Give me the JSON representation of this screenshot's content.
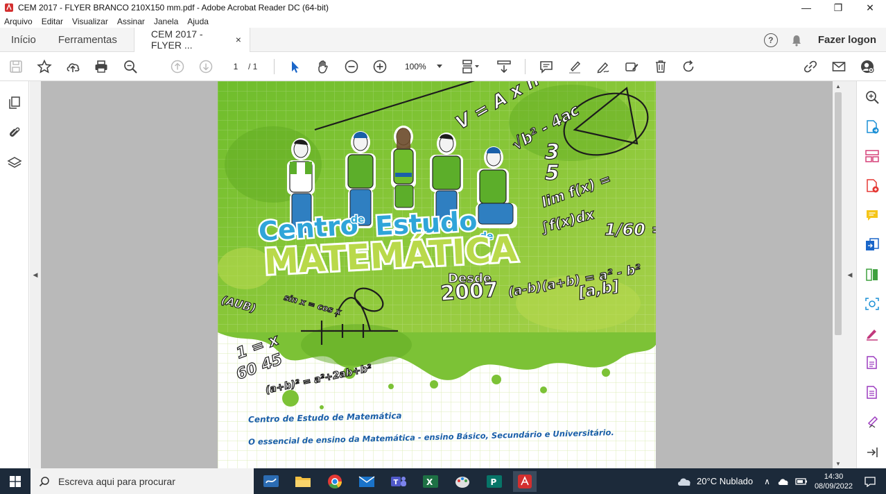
{
  "window": {
    "title": "CEM 2017 - FLYER BRANCO 210X150 mm.pdf - Adobe Acrobat Reader DC (64-bit)",
    "controls": {
      "minimize": "—",
      "restore": "❐",
      "close": "✕"
    }
  },
  "menu": [
    "Arquivo",
    "Editar",
    "Visualizar",
    "Assinar",
    "Janela",
    "Ajuda"
  ],
  "tabs": {
    "home": "Início",
    "tools": "Ferramentas",
    "document": "CEM 2017 - FLYER ...",
    "close": "×",
    "help": "?",
    "login": "Fazer logon"
  },
  "toolbar": {
    "page_current": "1",
    "page_total": "/ 1",
    "zoom": "100%"
  },
  "flyer": {
    "brand_line1": "Centro de Estudo de",
    "brand_word1": "Centro",
    "brand_small1": "de",
    "brand_word2": "Estudo",
    "brand_small2": "de",
    "brand_line2": "MATEMÁTICA",
    "since_label": "Desde",
    "since_year": "2007",
    "footer_line1": "Centro de Estudo de Matemática",
    "footer_line2": "O essencial de ensino da Matemática - ensino Básico, Secundário e Universitário.",
    "formula1": "lim f(x) =",
    "formula2": "∫f(x)dx",
    "formula3": "(a-b)(a+b) = a² - b²",
    "formula4": "[a,b]",
    "formula5": "1/60 = x/45"
  },
  "taskbar": {
    "search_placeholder": "Escreva aqui para procurar",
    "weather": "20°C  Nublado",
    "time": "14:30",
    "date": "08/09/2022"
  }
}
